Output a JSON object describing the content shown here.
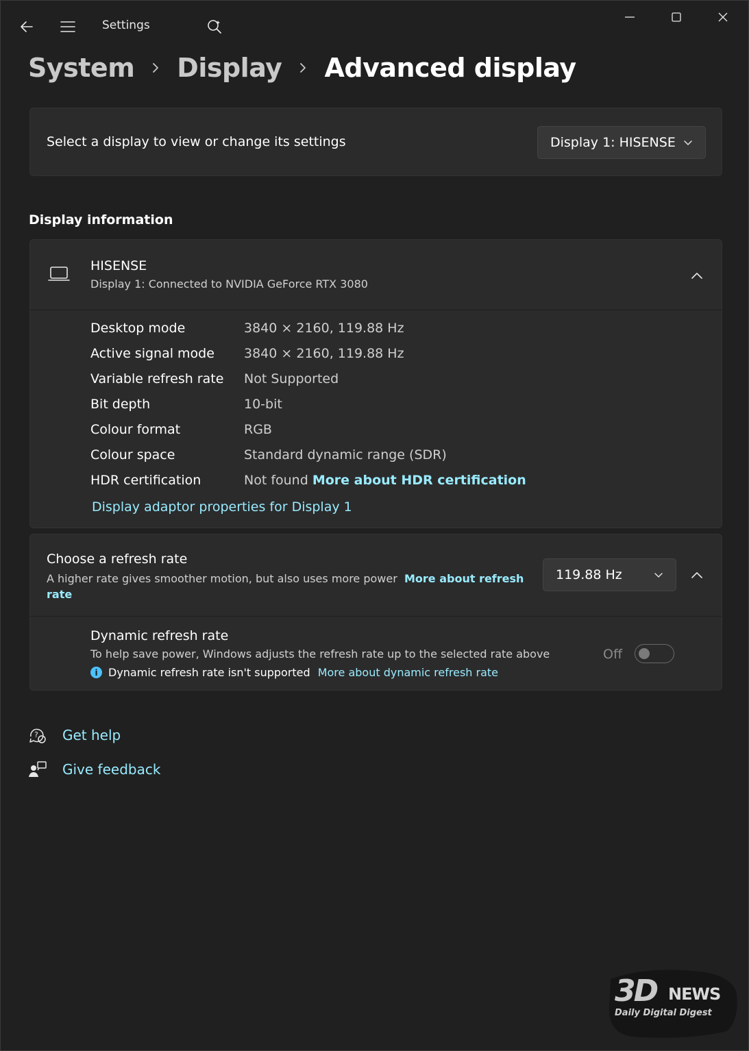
{
  "titlebar": {
    "app_title": "Settings",
    "icons": [
      "back-arrow-icon",
      "hamburger-menu-icon",
      "search-icon",
      "minimize-icon",
      "maximize-icon",
      "close-icon"
    ]
  },
  "breadcrumb": {
    "items": [
      "System",
      "Display",
      "Advanced display"
    ]
  },
  "display_select": {
    "label": "Select a display to view or change its settings",
    "selected": "Display 1: HISENSE"
  },
  "display_information": {
    "section_title": "Display information",
    "monitor_name": "HISENSE",
    "monitor_sub": "Display 1: Connected to NVIDIA GeForce RTX 3080",
    "rows": [
      {
        "key": "Desktop mode",
        "value": "3840 × 2160, 119.88 Hz"
      },
      {
        "key": "Active signal mode",
        "value": "3840 × 2160, 119.88 Hz"
      },
      {
        "key": "Variable refresh rate",
        "value": "Not Supported"
      },
      {
        "key": "Bit depth",
        "value": "10-bit"
      },
      {
        "key": "Colour format",
        "value": "RGB"
      },
      {
        "key": "Colour space",
        "value": "Standard dynamic range (SDR)"
      },
      {
        "key": "HDR certification",
        "value": "Not found",
        "link": "More about HDR certification"
      }
    ],
    "adaptor_link": "Display adaptor properties for Display 1"
  },
  "refresh_rate": {
    "title": "Choose a refresh rate",
    "description": "A higher rate gives smoother motion, but also uses more power",
    "link": "More about refresh rate",
    "selected": "119.88 Hz"
  },
  "dynamic_refresh": {
    "title": "Dynamic refresh rate",
    "description": "To help save power, Windows adjusts the refresh rate up to the selected rate above",
    "note": "Dynamic refresh rate isn't supported",
    "note_link": "More about dynamic refresh rate",
    "toggle_label": "Off",
    "toggle_on": false
  },
  "footer_links": {
    "get_help": "Get help",
    "give_feedback": "Give feedback"
  },
  "watermark": {
    "brand_3d": "3D",
    "brand_news": "NEWS",
    "tagline": "Daily Digital Digest"
  },
  "colors": {
    "background": "#202020",
    "card": "#2b2b2b",
    "link": "#99ebff",
    "accent": "#4cc2ff"
  }
}
